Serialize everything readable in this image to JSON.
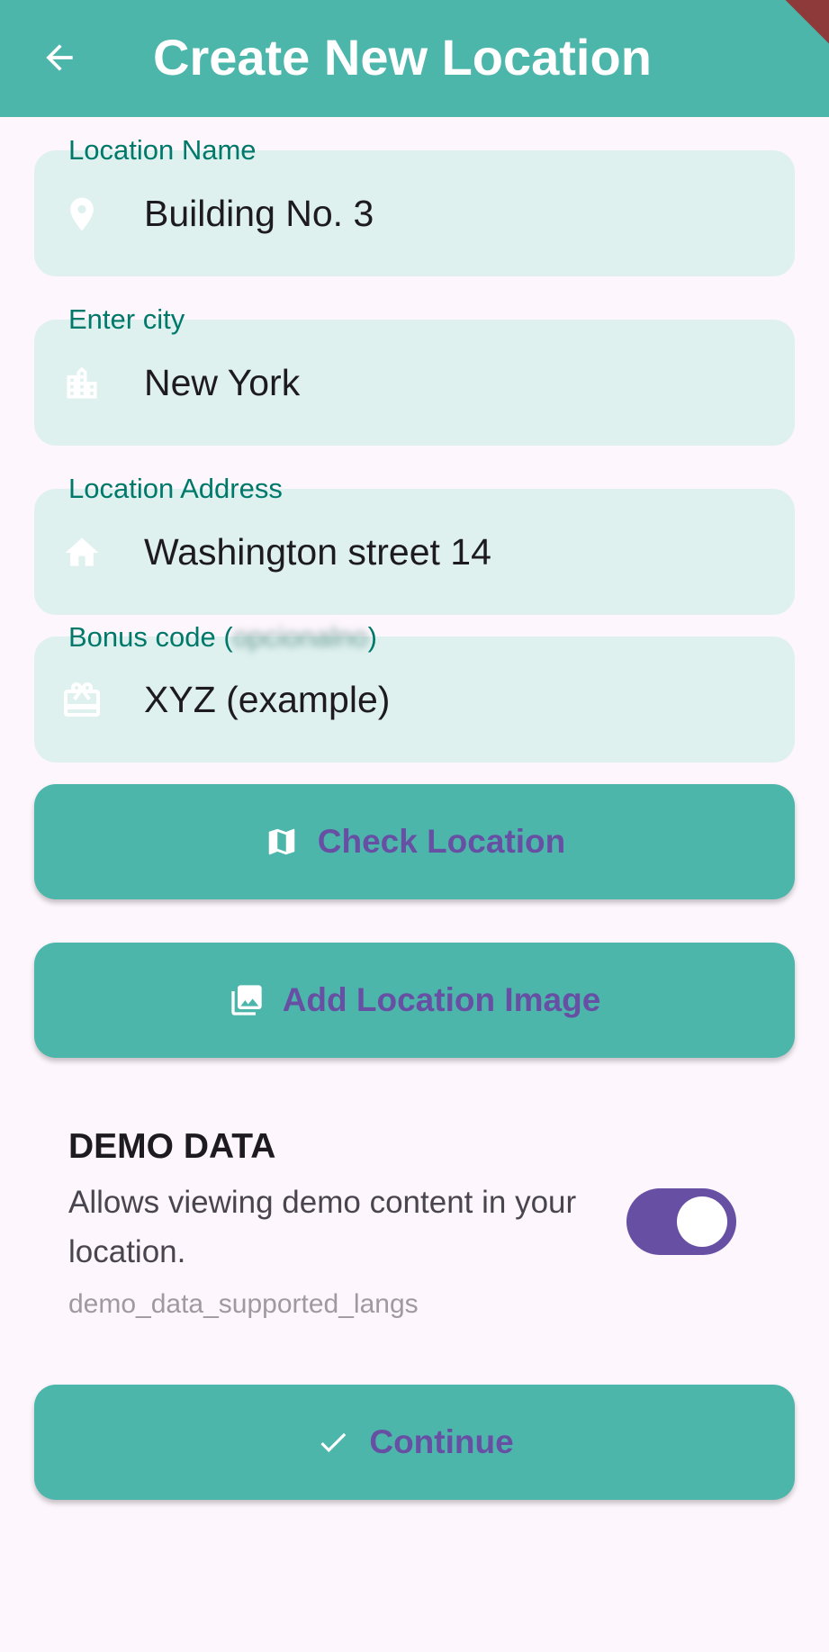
{
  "appbar": {
    "title": "Create New Location",
    "back_icon": "arrow-back-icon",
    "background": "#4db6ab"
  },
  "fields": [
    {
      "label": "Location Name",
      "value": "Building No. 3",
      "icon": "location-pin-icon"
    },
    {
      "label": "Enter city",
      "value": "New York",
      "icon": "city-icon"
    },
    {
      "label": "Location Address",
      "value": "Washington street 14",
      "icon": "home-icon"
    },
    {
      "label_prefix": "Bonus code (",
      "label_blurred": "opcionalno",
      "label_suffix": ")",
      "value": "XYZ (example)",
      "icon": "gift-card-icon"
    }
  ],
  "buttons": {
    "check_location": {
      "label": "Check Location",
      "icon": "map-icon"
    },
    "add_image": {
      "label": "Add Location Image",
      "icon": "photo-library-icon"
    },
    "continue": {
      "label": "Continue",
      "icon": "check-icon"
    }
  },
  "demo": {
    "title": "DEMO DATA",
    "description": "Allows viewing demo content in your location.",
    "langs": "demo_data_supported_langs",
    "toggle_on": true
  },
  "colors": {
    "accent": "#4db6ab",
    "field_bg": "#dff1ef",
    "label": "#00796b",
    "button_text": "#6750a4",
    "toggle": "#6750a4",
    "page_bg": "#fdf6fc"
  }
}
